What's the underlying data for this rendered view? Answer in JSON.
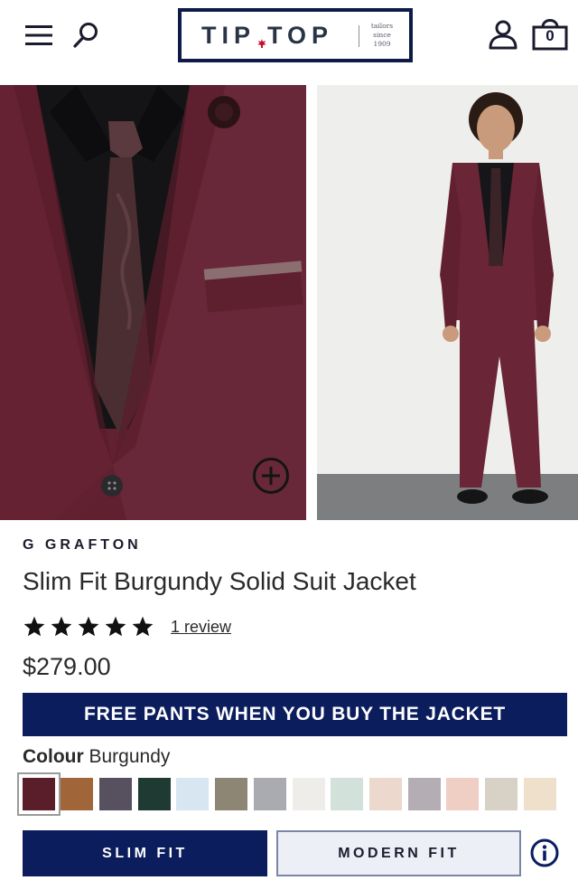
{
  "header": {
    "logo_text": "TIP TOP",
    "logo_tagline": [
      "tailors",
      "since",
      "1909"
    ],
    "bag_count": "0",
    "icons": [
      "menu-icon",
      "search-icon",
      "account-icon",
      "shopping-bag-icon"
    ]
  },
  "gallery": {
    "images": [
      "product-closeup-image",
      "product-full-model-image"
    ],
    "zoom_icon": "zoom-plus-icon"
  },
  "product": {
    "brand": "G GRAFTON",
    "title": "Slim Fit Burgundy Solid Suit Jacket",
    "rating": 5,
    "rating_max": 5,
    "review_link": "1 review",
    "price": "$279.00"
  },
  "promo": {
    "text": "FREE PANTS WHEN YOU BUY THE JACKET",
    "color": "#0b1d5c"
  },
  "colour": {
    "label": "Colour",
    "selected": "Burgundy",
    "swatches": [
      "#5a1e2b",
      "#a0663a",
      "#57515f",
      "#1e3a33",
      "#d7e6f0",
      "#8e8674",
      "#a9abb0",
      "#efedea",
      "#d2e1da",
      "#ecd8cc",
      "#b4adb3",
      "#efcfc4",
      "#d7d1c6",
      "#efe0cc"
    ]
  },
  "fit": {
    "options": [
      "SLIM FIT",
      "MODERN FIT"
    ],
    "selected": "SLIM FIT"
  },
  "colors": {
    "navy": "#0b1d5c",
    "text": "#2a2a2a"
  }
}
